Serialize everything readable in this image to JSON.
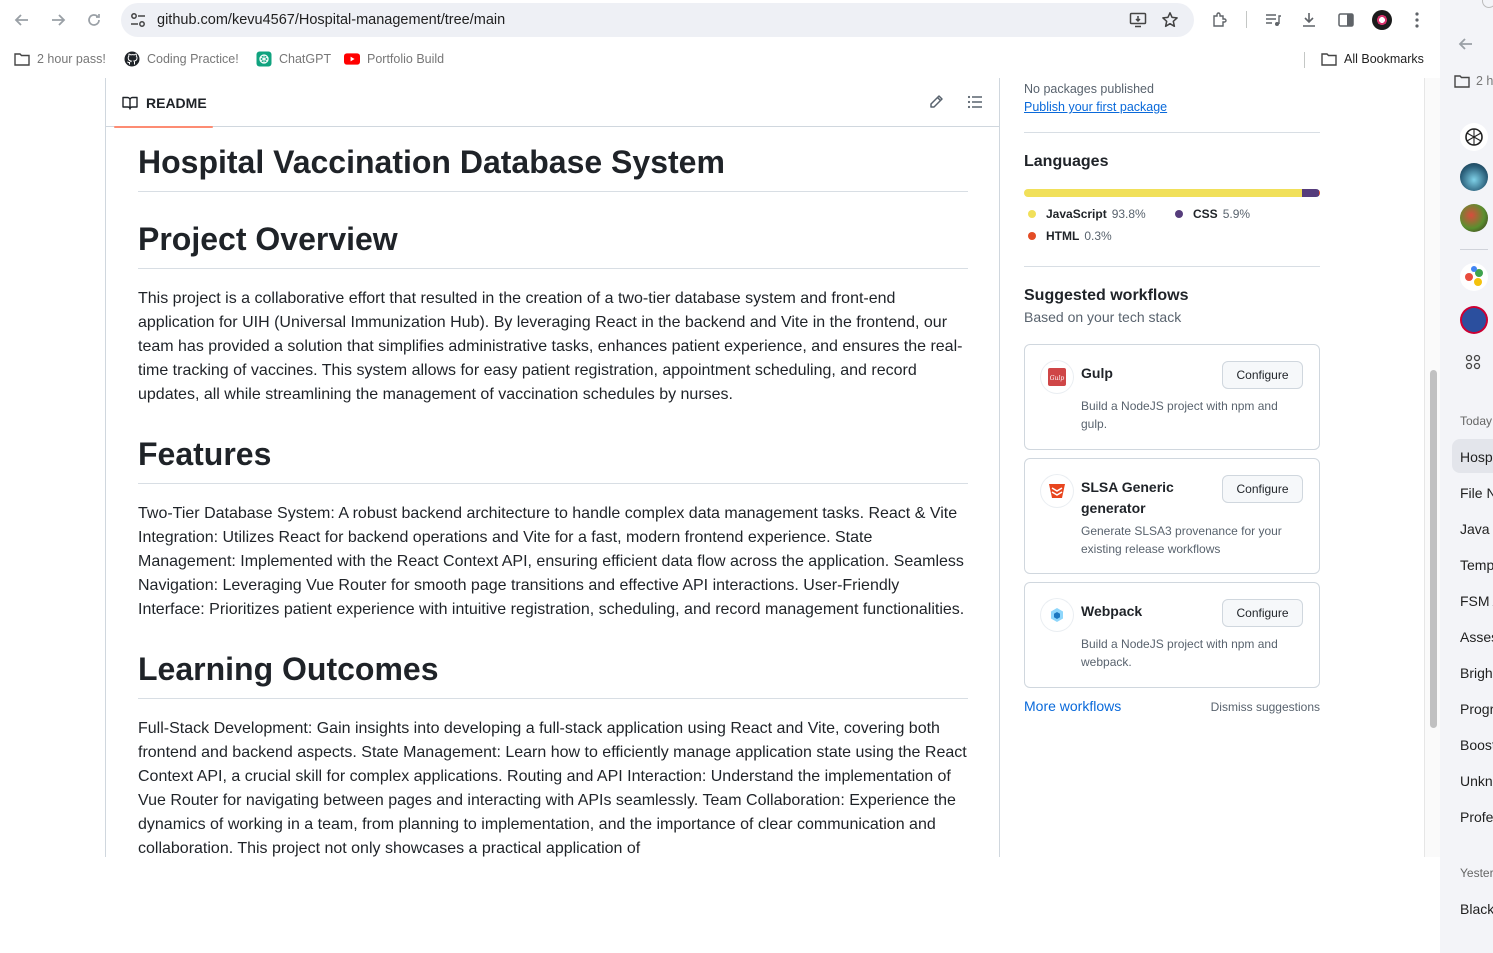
{
  "browser": {
    "url": "github.com/kevu4567/Hospital-management/tree/main",
    "bookmarks": [
      {
        "label": "2 hour pass!",
        "icon": "folder-icon"
      },
      {
        "label": "Coding Practice!",
        "icon": "github-icon"
      },
      {
        "label": "ChatGPT",
        "icon": "chatgpt-icon"
      },
      {
        "label": "Portfolio Build",
        "icon": "youtube-icon"
      }
    ],
    "all_bookmarks": "All Bookmarks"
  },
  "readme": {
    "tab_label": "README",
    "title": "Hospital Vaccination Database System",
    "sections": [
      {
        "heading": "Project Overview",
        "body": "This project is a collaborative effort that resulted in the creation of a two-tier database system and front-end application for UIH (Universal Immunization Hub). By leveraging React in the backend and Vite in the frontend, our team has provided a solution that simplifies administrative tasks, enhances patient experience, and ensures the real-time tracking of vaccines. This system allows for easy patient registration, appointment scheduling, and record updates, all while streamlining the management of vaccination schedules by nurses."
      },
      {
        "heading": "Features",
        "body": "Two-Tier Database System: A robust backend architecture to handle complex data management tasks. React & Vite Integration: Utilizes React for backend operations and Vite for a fast, modern frontend experience. State Management: Implemented with the React Context API, ensuring efficient data flow across the application. Seamless Navigation: Leveraging Vue Router for smooth page transitions and effective API interactions. User-Friendly Interface: Prioritizes patient experience with intuitive registration, scheduling, and record management functionalities."
      },
      {
        "heading": "Learning Outcomes",
        "body": "Full-Stack Development: Gain insights into developing a full-stack application using React and Vite, covering both frontend and backend aspects. State Management: Learn how to efficiently manage application state using the React Context API, a crucial skill for complex applications. Routing and API Interaction: Understand the implementation of Vue Router for navigating between pages and interacting with APIs seamlessly. Team Collaboration: Experience the dynamics of working in a team, from planning to implementation, and the importance of clear communication and collaboration. This project not only showcases a practical application of"
      }
    ]
  },
  "sidebar": {
    "packages_none": "No packages published",
    "packages_link": "Publish your first package",
    "languages_title": "Languages",
    "languages": [
      {
        "name": "JavaScript",
        "percent": "93.8%",
        "value": 93.8,
        "color": "#f1e05a"
      },
      {
        "name": "CSS",
        "percent": "5.9%",
        "value": 5.9,
        "color": "#563d7c"
      },
      {
        "name": "HTML",
        "percent": "0.3%",
        "value": 0.3,
        "color": "#e34c26"
      }
    ],
    "workflows_title": "Suggested workflows",
    "workflows_subtitle": "Based on your tech stack",
    "workflows": [
      {
        "name": "Gulp",
        "desc": "Build a NodeJS project with npm and gulp.",
        "button": "Configure",
        "icon": "gulp-icon"
      },
      {
        "name": "SLSA Generic generator",
        "desc": "Generate SLSA3 provenance for your existing release workflows",
        "button": "Configure",
        "icon": "slsa-icon"
      },
      {
        "name": "Webpack",
        "desc": "Build a NodeJS project with npm and webpack.",
        "button": "Configure",
        "icon": "webpack-icon"
      }
    ],
    "more_workflows": "More workflows",
    "dismiss": "Dismiss suggestions"
  },
  "side_panel": {
    "bookmark_folder": "2 h",
    "today_label": "Today",
    "items": [
      "Hosp",
      "File N",
      "Java C",
      "Temp",
      "FSM A",
      "Asses",
      "Brigh",
      "Progr",
      "Boost",
      "Unkn",
      "Profe"
    ],
    "yesterday_label": "Yester",
    "yesterday_items": [
      "Black"
    ]
  }
}
